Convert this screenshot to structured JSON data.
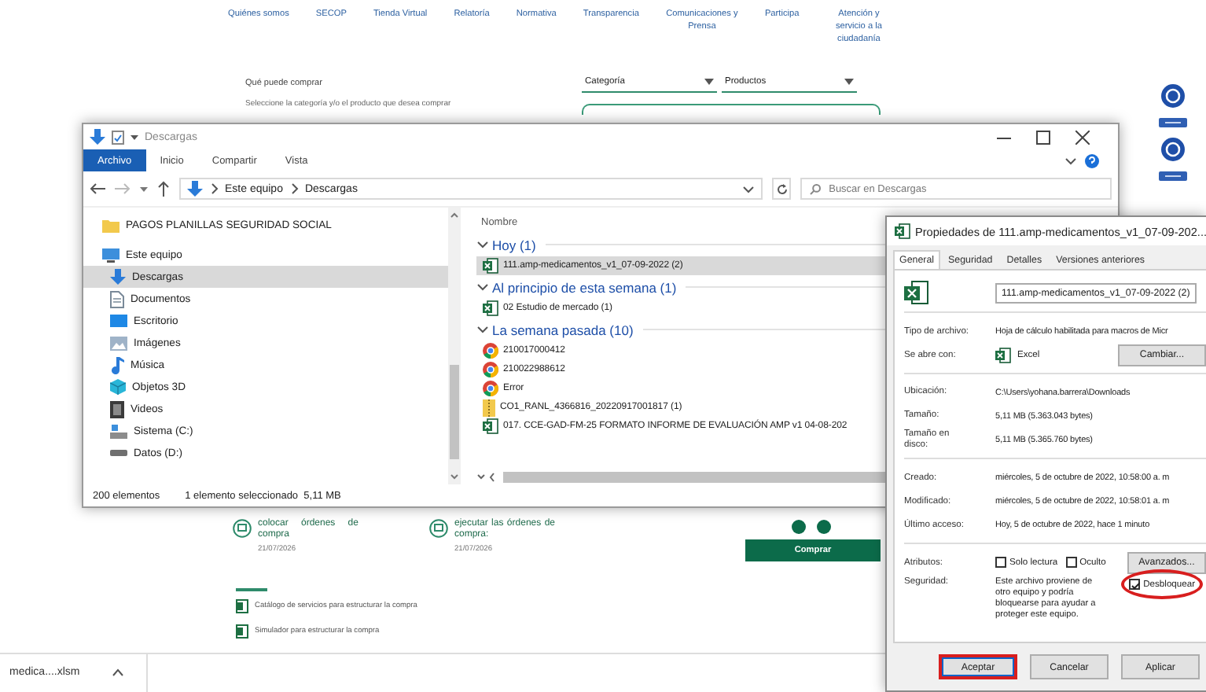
{
  "website": {
    "nav": [
      {
        "label": "Quiénes somos"
      },
      {
        "label": "SECOP"
      },
      {
        "label": "Tienda Virtual"
      },
      {
        "label": "Relatoría"
      },
      {
        "label": "Normativa"
      },
      {
        "label": "Transparencia"
      },
      {
        "label": "Comunicaciones y Prensa"
      },
      {
        "label": "Participa"
      },
      {
        "label": "Atención y servicio a la ciudadanía"
      }
    ],
    "section_title": "Qué puede comprar",
    "section_hint": "Seleccione la categoría y/o el producto que desea comprar",
    "filters": [
      {
        "label": "Categoría"
      },
      {
        "label": "Productos"
      }
    ],
    "cards": [
      {
        "text": "colocar órdenes de compra",
        "date": "21/07/2026"
      },
      {
        "text": "ejecutar las órdenes de compra:",
        "date": "21/07/2026"
      }
    ],
    "buy_button": "Comprar",
    "documents": [
      {
        "label": "Catálogo de servicios para estructurar la compra"
      },
      {
        "label": "Simulador para estructurar la compra"
      }
    ]
  },
  "explorer": {
    "title": "Descargas",
    "ribbon_tabs": [
      {
        "label": "Archivo",
        "selected": true
      },
      {
        "label": "Inicio",
        "selected": false
      },
      {
        "label": "Compartir",
        "selected": false
      },
      {
        "label": "Vista",
        "selected": false
      }
    ],
    "breadcrumb": [
      "Este equipo",
      "Descargas"
    ],
    "search": {
      "placeholder": "Buscar en Descargas"
    },
    "nav": [
      {
        "label": "PAGOS PLANILLAS SEGURIDAD SOCIAL",
        "kind": "folder",
        "selected": false
      },
      {
        "label": "Este equipo",
        "kind": "pc",
        "selected": false,
        "children": [
          {
            "label": "Descargas",
            "kind": "downloads",
            "selected": true
          },
          {
            "label": "Documentos",
            "kind": "documents",
            "selected": false
          },
          {
            "label": "Escritorio",
            "kind": "desktop",
            "selected": false
          },
          {
            "label": "Imágenes",
            "kind": "pictures",
            "selected": false
          },
          {
            "label": "Música",
            "kind": "music",
            "selected": false
          },
          {
            "label": "Objetos 3D",
            "kind": "objects",
            "selected": false
          },
          {
            "label": "Videos",
            "kind": "videos",
            "selected": false
          },
          {
            "label": "Sistema (C:)",
            "kind": "system",
            "selected": false
          },
          {
            "label": "Datos (D:)",
            "kind": "drive",
            "selected": false
          }
        ]
      }
    ],
    "column": "Nombre",
    "groups": [
      {
        "label": "Hoy (1)",
        "expanded": true,
        "files": [
          {
            "name": "111.amp-medicamentos_v1_07-09-2022 (2)",
            "kind": "excel",
            "selected": true
          }
        ]
      },
      {
        "label": "Al principio de esta semana (1)",
        "expanded": true,
        "files": [
          {
            "name": "02 Estudio de mercado (1)",
            "kind": "excel",
            "selected": false
          }
        ]
      },
      {
        "label": "La semana pasada (10)",
        "expanded": true,
        "files": [
          {
            "name": "210017000412",
            "kind": "chrome",
            "selected": false
          },
          {
            "name": "210022988612",
            "kind": "chrome",
            "selected": false
          },
          {
            "name": "Error",
            "kind": "chrome",
            "selected": false
          },
          {
            "name": "CO1_RANL_4366816_20220917001817 (1)",
            "kind": "zip",
            "selected": false
          },
          {
            "name": "017. CCE-GAD-FM-25 FORMATO INFORME DE EVALUACIÓN AMP v1 04-08-202",
            "kind": "excel",
            "selected": false
          }
        ]
      }
    ],
    "status": {
      "count": "200 elementos",
      "selection": "1 elemento seleccionado  5,11 MB"
    }
  },
  "properties": {
    "title": "Propiedades de 111.amp-medicamentos_v1_07-09-202...",
    "tabs": [
      {
        "label": "General",
        "selected": true
      },
      {
        "label": "Seguridad",
        "selected": false
      },
      {
        "label": "Detalles",
        "selected": false
      },
      {
        "label": "Versiones anteriores",
        "selected": false
      }
    ],
    "file_name": "111.amp-medicamentos_v1_07-09-2022 (2)",
    "type_label": "Tipo de archivo:",
    "type_value": "Hoja de cálculo habilitada para macros de Micr",
    "opens_label": "Se abre con:",
    "opens_app": "Excel",
    "change_button": "Cambiar...",
    "location_rows": [
      {
        "label": "Ubicación:",
        "value": "C:\\Users\\yohana.barrera\\Downloads"
      },
      {
        "label": "Tamaño:",
        "value": "5,11 MB (5.363.043 bytes)"
      },
      {
        "label": "Tamaño en disco:",
        "value": "5,11 MB (5.365.760 bytes)"
      }
    ],
    "date_rows": [
      {
        "label": "Creado:",
        "value": "miércoles, 5 de octubre de 2022, 10:58:00 a. m"
      },
      {
        "label": "Modificado:",
        "value": "miércoles, 5 de octubre de 2022, 10:58:01 a. m"
      },
      {
        "label": "Último acceso:",
        "value": "Hoy, 5 de octubre de 2022, hace 1 minuto"
      }
    ],
    "attributes": {
      "label": "Atributos:",
      "checkboxes": [
        {
          "label": "Solo lectura",
          "checked": false
        },
        {
          "label": "Oculto",
          "checked": false
        }
      ],
      "advanced_button": "Avanzados..."
    },
    "security": {
      "label": "Seguridad:",
      "text": "Este archivo proviene de otro equipo y podría bloquearse para ayudar a proteger este equipo.",
      "unblock": {
        "label": "Desbloquear",
        "checked": true,
        "highlighted": true
      }
    },
    "buttons": [
      {
        "label": "Aceptar",
        "highlighted": true
      },
      {
        "label": "Cancelar",
        "highlighted": false
      },
      {
        "label": "Aplicar",
        "highlighted": false
      }
    ]
  },
  "download_bar": {
    "file": "medica....xlsm"
  }
}
